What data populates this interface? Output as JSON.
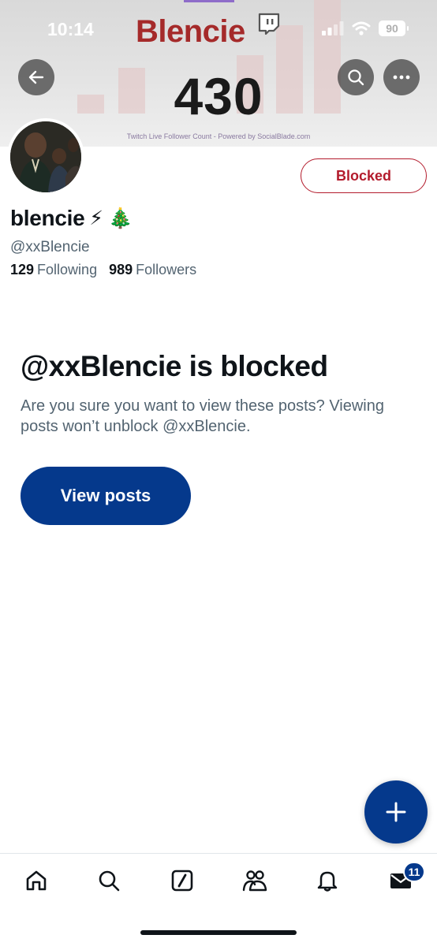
{
  "status_bar": {
    "time": "10:14",
    "battery": "90"
  },
  "banner": {
    "brand": "Blencie",
    "count": "430",
    "caption": "Twitch Live Follower Count - Powered by SocialBlade.com"
  },
  "header": {
    "back_icon": "arrow-left-icon",
    "search_icon": "search-icon",
    "more_icon": "more-horizontal-icon"
  },
  "profile": {
    "display_name": "blencie",
    "name_emojis": "⚡ 🎄",
    "handle": "@xxBlencie",
    "following_count": "129",
    "following_label": "Following",
    "followers_count": "989",
    "followers_label": "Followers",
    "blocked_button": "Blocked"
  },
  "notice": {
    "title": "@xxBlencie is blocked",
    "body": "Are you sure you want to view these posts? Viewing posts won’t unblock @xxBlencie.",
    "view_button": "View posts"
  },
  "fab": {
    "icon": "plus-icon"
  },
  "tabbar": {
    "items": [
      {
        "icon": "home-icon"
      },
      {
        "icon": "search-icon"
      },
      {
        "icon": "grok-icon"
      },
      {
        "icon": "communities-icon"
      },
      {
        "icon": "notifications-bell-icon"
      },
      {
        "icon": "messages-envelope-icon"
      }
    ],
    "messages_badge": "11"
  },
  "colors": {
    "accent": "#05398c",
    "blocked": "#b31b2c",
    "text_primary": "#0f1419",
    "text_secondary": "#536471",
    "banner_brand": "#a52a2a"
  }
}
